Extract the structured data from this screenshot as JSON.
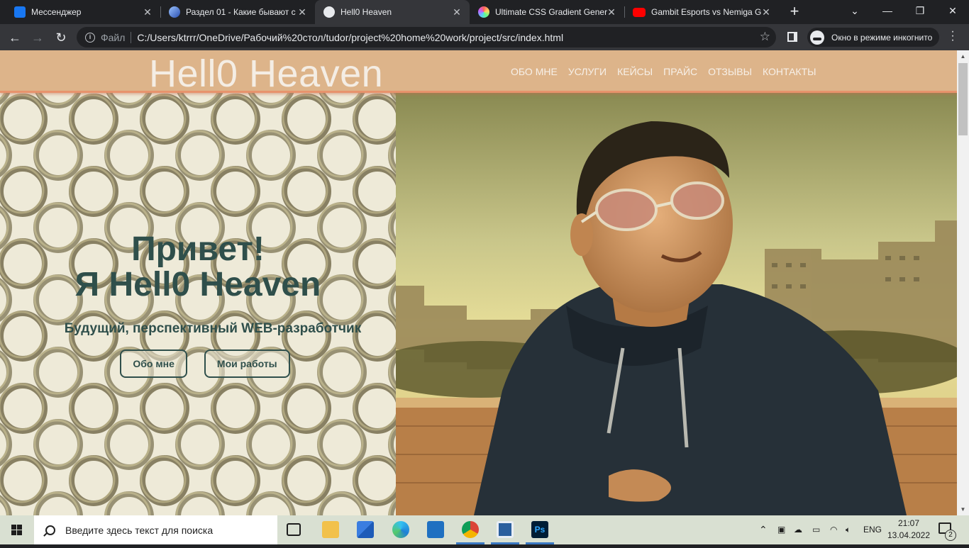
{
  "browser": {
    "tabs": [
      {
        "title": "Мессенджер",
        "favicon": "messenger-icon",
        "color": "#1877f2",
        "active": false
      },
      {
        "title": "Раздел 01 - Какие бывают с",
        "favicon": "skillbox-icon",
        "color": "#4f7bd9",
        "active": false
      },
      {
        "title": "Hell0 Heaven",
        "favicon": "globe-icon",
        "color": "#e8eaed",
        "active": true
      },
      {
        "title": "Ultimate CSS Gradient Gener",
        "favicon": "gradient-icon",
        "color": "#c86dd7",
        "active": false
      },
      {
        "title": "Gambit Esports vs Nemiga G",
        "favicon": "youtube-icon",
        "color": "#ff0000",
        "active": false
      }
    ],
    "address": {
      "scheme_label": "Файл",
      "url": "C:/Users/ktrrr/OneDrive/Рабочий%20стол/tudor/project%20home%20work/project/src/index.html"
    },
    "incognito_label": "Окно в режиме инкогнито"
  },
  "site": {
    "logo": "Hell0 Heaven",
    "nav": [
      "ОБО МНЕ",
      "УСЛУГИ",
      "КЕЙСЫ",
      "ПРАЙС",
      "ОТЗЫВЫ",
      "КОНТАКТЫ"
    ],
    "hero": {
      "title_line1": "Привет!",
      "title_line2": "Я Hell0 Heaven",
      "subtitle": "Будущий, перспективный WEB-разработчик",
      "button_about": "Обо мне",
      "button_works": "Мои работы"
    },
    "colors": {
      "header_bg": "#ddb48a",
      "header_border": "#e7936c",
      "text_dark": "#2f4f4b"
    }
  },
  "taskbar": {
    "search_placeholder": "Введите здесь текст для поиска",
    "language": "ENG",
    "time": "21:07",
    "date": "13.04.2022",
    "notifications": "2"
  }
}
